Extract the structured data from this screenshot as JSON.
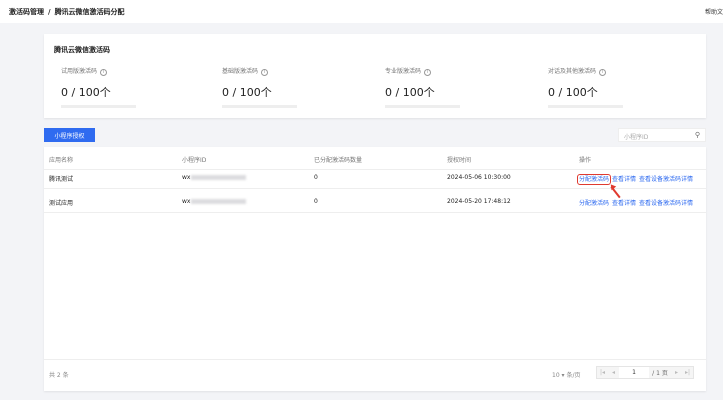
{
  "breadcrumb": {
    "parent": "激活码管理",
    "separator": "/",
    "current": "腾讯云微信激活码分配"
  },
  "help_link": "帮助文",
  "summary": {
    "title": "腾讯云微信激活码",
    "stats": [
      {
        "label": "试用版激活码",
        "value": "0 / 100个",
        "fill": 0
      },
      {
        "label": "基础版激活码",
        "value": "0 / 100个",
        "fill": 0
      },
      {
        "label": "专业版激活码",
        "value": "0 / 100个",
        "fill": 0
      },
      {
        "label": "对话及其他激活码",
        "value": "0 / 100个",
        "fill": 0
      }
    ]
  },
  "toolbar": {
    "authorize_label": "小程序授权",
    "search_placeholder": "小程序ID"
  },
  "table": {
    "columns": [
      "应用名称",
      "小程序ID",
      "已分配激活码数量",
      "授权时间",
      "操作"
    ],
    "rows": [
      {
        "name": "腾讯测试",
        "appid": "wx",
        "count": "0",
        "time": "2024-05-06 10:30:00",
        "actions": [
          "分配激活码",
          "查看详情",
          "查看设备激活码详情"
        ]
      },
      {
        "name": "测试应用",
        "appid": "wx",
        "count": "0",
        "time": "2024-05-20 17:48:12",
        "actions": [
          "分配激活码",
          "查看详情",
          "查看设备激活码详情"
        ]
      }
    ]
  },
  "pagination": {
    "total": "共 2 条",
    "page_size": "10 ▾ 条/页",
    "page": "1",
    "pages": "/ 1 页"
  },
  "colors": {
    "accent": "#2f6bf0",
    "highlight": "#e03a2f"
  }
}
